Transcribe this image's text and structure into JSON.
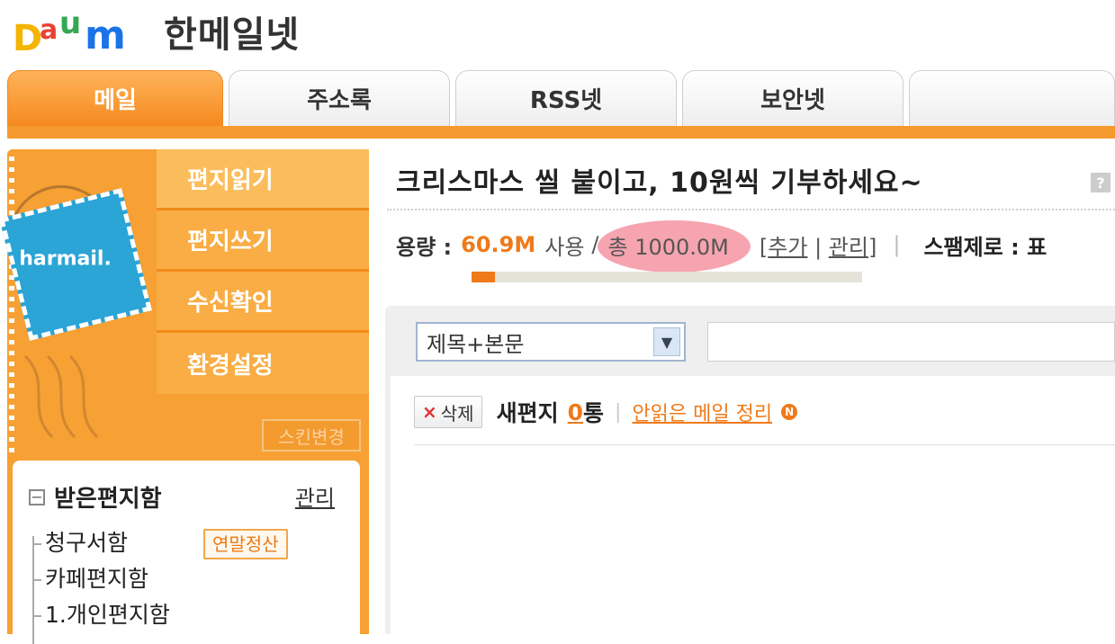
{
  "header": {
    "brand_letters": [
      "D",
      "a",
      "u",
      "m"
    ],
    "service_title": "한메일넷"
  },
  "tabs": [
    {
      "label": "메일",
      "active": true
    },
    {
      "label": "주소록",
      "active": false
    },
    {
      "label": "RSS넷",
      "active": false
    },
    {
      "label": "보안넷",
      "active": false
    },
    {
      "label": "",
      "active": false
    }
  ],
  "colors": {
    "accent": "#f59a2f",
    "highlight": "#ef7a1a",
    "stamp": "#2ba4d6"
  },
  "sidebar": {
    "stamp_text": "harmail.",
    "menu": [
      {
        "label": "편지읽기"
      },
      {
        "label": "편지쓰기"
      },
      {
        "label": "수신확인"
      },
      {
        "label": "환경설정"
      }
    ],
    "skin_button": "스킨변경",
    "folders": {
      "title": "받은편지함",
      "manage": "관리",
      "items": [
        {
          "label": "청구서함",
          "badge": "연말정산"
        },
        {
          "label": "카페편지함"
        },
        {
          "label": "1.개인편지함"
        }
      ]
    }
  },
  "main": {
    "promo": "크리스마스 씰 붙이고, 10원씩 기부하세요~",
    "help_icon": "?",
    "quota": {
      "label": "용량 :",
      "used": "60.9M",
      "use_word": "사용",
      "separator": "/",
      "total": "총 1000.0M",
      "add_link": "추가",
      "manage_link": "관리",
      "spam_label": "스팸제로 : 표",
      "usage_fraction": 0.06
    },
    "search": {
      "scope": "제목+본문",
      "query": ""
    },
    "toolbar": {
      "delete": "삭제",
      "delete_icon": "×",
      "new_mail_label": "새편지",
      "new_mail_count": "0",
      "count_unit": "통",
      "unread_cleanup": "안읽은 메일 정리",
      "new_icon": "N"
    }
  }
}
